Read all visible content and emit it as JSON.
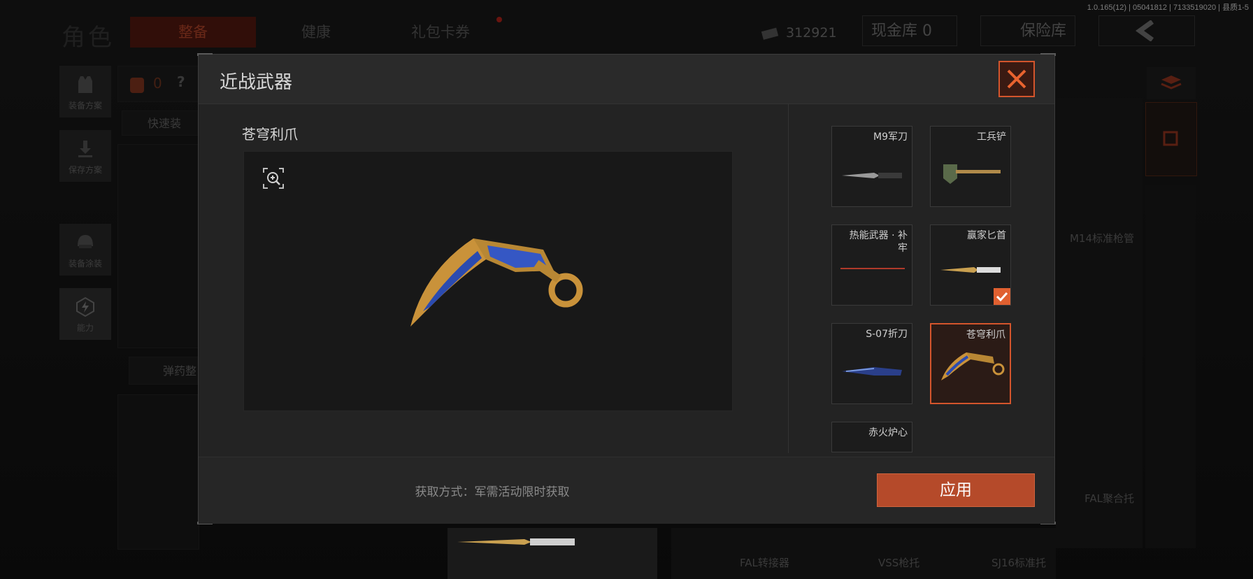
{
  "version_info": "1.0.165(12) | 05041812 | 7133519020 | 县质1-5",
  "background": {
    "role_title": "角色",
    "tabs": [
      {
        "label": "整备",
        "active": true
      },
      {
        "label": "健康",
        "active": false
      },
      {
        "label": "礼包卡券",
        "active": false,
        "has_notification": true
      }
    ],
    "money": "312921",
    "cash_vault": "现金库 0",
    "insurance_vault": "保险库",
    "left_buttons": [
      {
        "label": "装备方案",
        "icon": "vest-icon"
      },
      {
        "label": "保存方案",
        "icon": "download-icon"
      },
      {
        "label": "装备涂装",
        "icon": "helmet-icon"
      },
      {
        "label": "能力",
        "icon": "ability-icon"
      }
    ],
    "bag_count": "0",
    "help_icon": "?",
    "quick_equip": "快速装",
    "ammo_arrange": "弹药整",
    "right_labels": [
      "M14标准枪管",
      "FAL聚合托"
    ],
    "bottom_labels": [
      "FAL转接器",
      "VSS枪托",
      "SJ16标准托"
    ]
  },
  "modal": {
    "title": "近战武器",
    "selected_weapon_name": "苍穹利爪",
    "acquire_method": "获取方式：军需活动限时获取",
    "apply_label": "应用",
    "weapons": [
      {
        "name": "M9军刀",
        "selected": false,
        "equipped": false
      },
      {
        "name": "工兵铲",
        "selected": false,
        "equipped": false
      },
      {
        "name": "热能武器 · 补牢",
        "selected": false,
        "equipped": false
      },
      {
        "name": "赢家匕首",
        "selected": false,
        "equipped": true
      },
      {
        "name": "S-07折刀",
        "selected": false,
        "equipped": false
      },
      {
        "name": "苍穹利爪",
        "selected": true,
        "equipped": false
      },
      {
        "name": "赤火炉心",
        "selected": false,
        "equipped": false
      }
    ]
  },
  "colors": {
    "accent": "#d4552c",
    "apply_bg": "#b54a2a",
    "active_tab_bg": "#5a1a12"
  }
}
